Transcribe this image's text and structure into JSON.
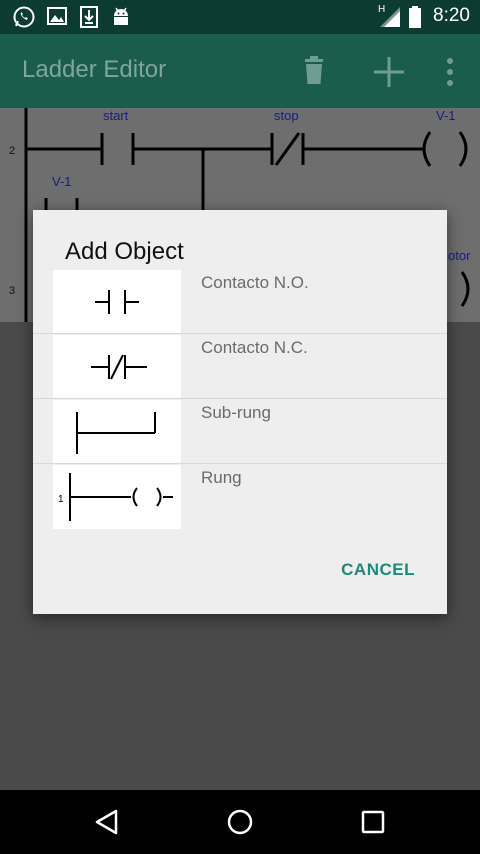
{
  "status_bar": {
    "time": "8:20",
    "network_label": "H",
    "icons": [
      "whatsapp-icon",
      "image-icon",
      "download-icon",
      "android-icon",
      "signal-icon",
      "battery-icon"
    ]
  },
  "app_bar": {
    "title": "Ladder Editor",
    "actions": [
      "delete-icon",
      "add-icon",
      "more-vert-icon"
    ]
  },
  "ladder": {
    "rung_numbers": [
      "2",
      "3"
    ],
    "labels": [
      "start",
      "stop",
      "V-1",
      "V-1",
      "otor"
    ]
  },
  "dialog": {
    "title": "Add Object",
    "options": [
      {
        "label": "Contacto N.O.",
        "icon": "normally-open-contact-icon"
      },
      {
        "label": "Contacto N.C.",
        "icon": "normally-closed-contact-icon"
      },
      {
        "label": "Sub-rung",
        "icon": "sub-rung-icon"
      },
      {
        "label": "Rung",
        "icon": "rung-icon",
        "number": "1"
      }
    ],
    "cancel_label": "CANCEL"
  },
  "nav_bar": {
    "buttons": [
      "back-icon",
      "home-icon",
      "recents-icon"
    ]
  },
  "colors": {
    "status_bar": "#0c3b33",
    "app_bar": "#1a5c4d",
    "accent": "#1f8a78",
    "dialog_bg": "#eeeeee",
    "scrim": "#4a4a4a"
  }
}
